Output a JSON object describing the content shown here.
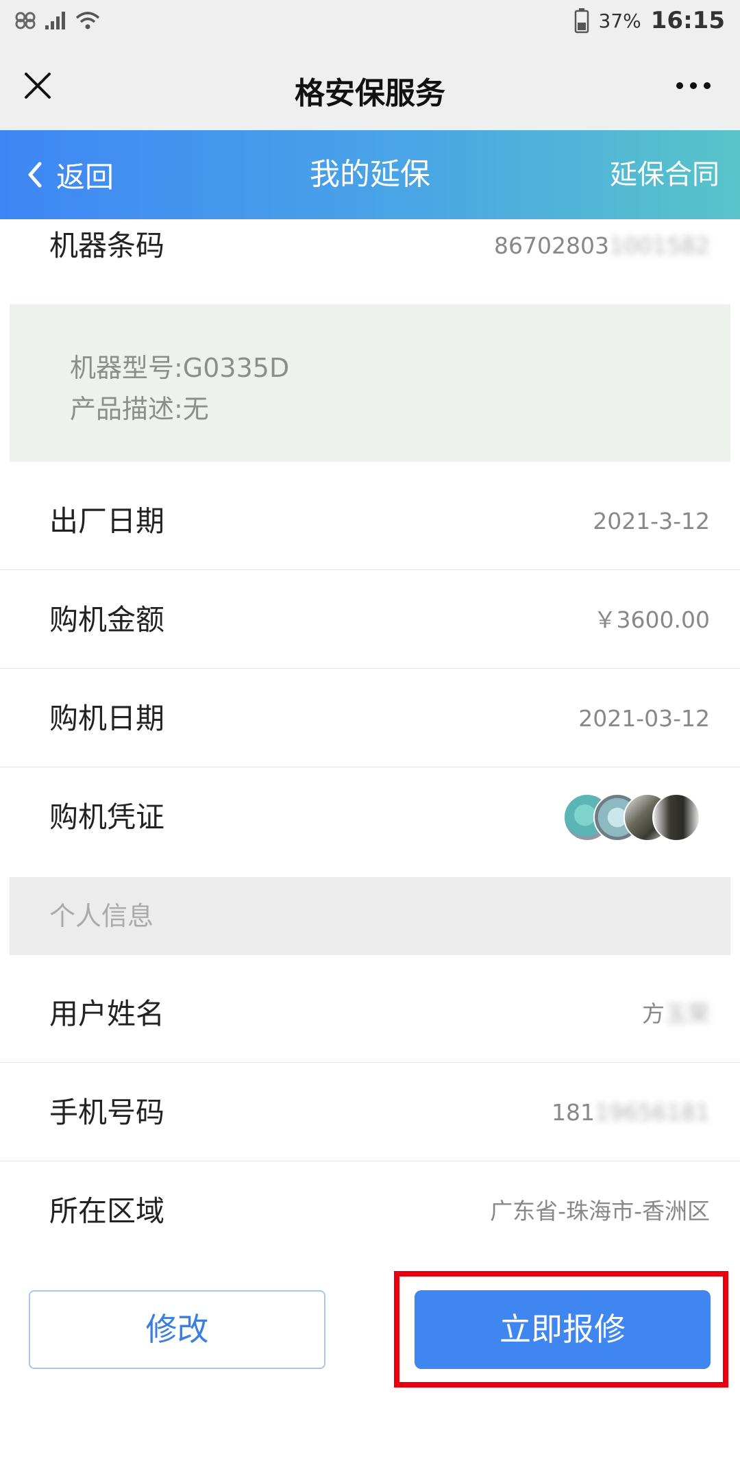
{
  "status_bar": {
    "battery_percent": "37%",
    "time": "16:15"
  },
  "title_bar": {
    "title": "格安保服务"
  },
  "nav": {
    "back_label": "返回",
    "title": "我的延保",
    "contract_label": "延保合同"
  },
  "product": {
    "barcode_label": "机器条码",
    "barcode_value_visible": "86702803",
    "barcode_value_blurred": "1001582",
    "model_line": "机器型号:G0335D",
    "description_line": "产品描述:无"
  },
  "details": {
    "factory_date_label": "出厂日期",
    "factory_date_value": "2021-3-12",
    "price_label": "购机金额",
    "price_value": "￥3600.00",
    "purchase_date_label": "购机日期",
    "purchase_date_value": "2021-03-12",
    "voucher_label": "购机凭证"
  },
  "personal": {
    "section_title": "个人信息",
    "name_label": "用户姓名",
    "name_visible": "方",
    "name_blurred": "玉荣",
    "phone_label": "手机号码",
    "phone_visible": "181",
    "phone_blurred": "19656181",
    "region_label": "所在区域",
    "region_value": "广东省-珠海市-香洲区"
  },
  "actions": {
    "edit_label": "修改",
    "repair_label": "立即报修"
  },
  "colors": {
    "accent_blue": "#3f86f0",
    "highlight_red": "#e8000f"
  }
}
